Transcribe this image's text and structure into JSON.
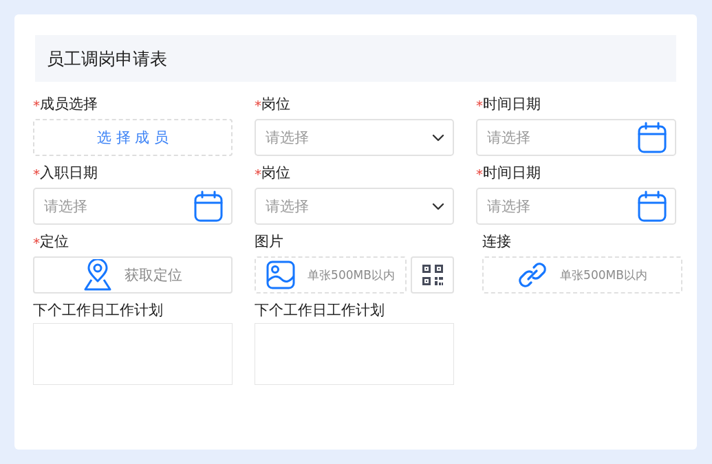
{
  "form": {
    "title": "员工调岗申请表",
    "fields": [
      {
        "kind": "member",
        "mark": "*",
        "label": "成员选择",
        "button": "选 择 成 员"
      },
      {
        "kind": "select",
        "mark": "*",
        "label": "岗位",
        "placeholder": "请选择"
      },
      {
        "kind": "date",
        "mark": "*",
        "label": "时间日期",
        "placeholder": "请选择"
      },
      {
        "kind": "date",
        "mark": "*",
        "label": "入职日期",
        "placeholder": "请选择"
      },
      {
        "kind": "select",
        "mark": "*",
        "label": "岗位",
        "placeholder": "请选择"
      },
      {
        "kind": "date",
        "mark": "*",
        "label": "时间日期",
        "placeholder": "请选择"
      },
      {
        "kind": "location",
        "mark": "*",
        "label": "定位",
        "button": "获取定位"
      },
      {
        "kind": "image",
        "label": "图片",
        "hint": "单张500MB以内"
      },
      {
        "kind": "link",
        "label": "连接",
        "hint": "单张500MB以内"
      },
      {
        "kind": "textarea",
        "label": "下个工作日工作计划"
      },
      {
        "kind": "textarea",
        "label": "下个工作日工作计划"
      }
    ]
  }
}
